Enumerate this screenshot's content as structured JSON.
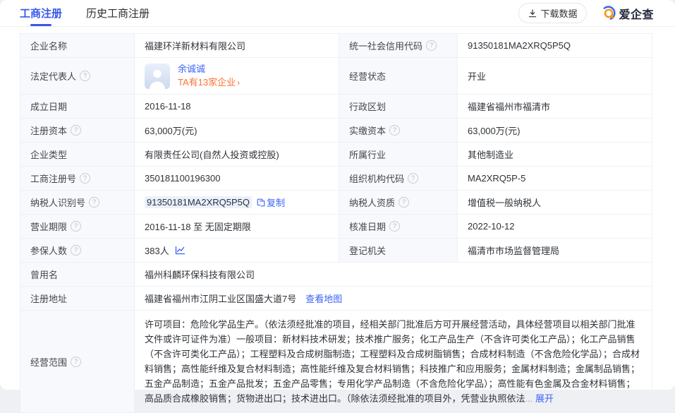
{
  "header": {
    "tabs": [
      {
        "label": "工商注册"
      },
      {
        "label": "历史工商注册"
      }
    ],
    "download_label": "下载数据",
    "brand_name": "爱企查"
  },
  "colors": {
    "accent_blue": "#3a57e8",
    "link_blue": "#3e63f6",
    "link_orange": "#ff7033",
    "brand_orange": "#ff9412",
    "brand_blue": "#2e66f6",
    "label_bg": "#f7f9fc",
    "border": "#edf0f4"
  },
  "fields": {
    "company_name": {
      "label": "企业名称",
      "value": "福建环洋新材料有限公司"
    },
    "credit_code": {
      "label": "统一社会信用代码",
      "value": "91350181MA2XRQ5P5Q"
    },
    "legal_rep": {
      "label": "法定代表人",
      "name": "余诚诚",
      "companies_link": "TA有13家企业",
      "arrow": "›"
    },
    "status": {
      "label": "经营状态",
      "value": "开业"
    },
    "established": {
      "label": "成立日期",
      "value": "2016-11-18"
    },
    "admin_division": {
      "label": "行政区划",
      "value": "福建省福州市福清市"
    },
    "reg_capital": {
      "label": "注册资本",
      "value": "63,000万(元)"
    },
    "paid_capital": {
      "label": "实缴资本",
      "value": "63,000万(元)"
    },
    "company_type": {
      "label": "企业类型",
      "value": "有限责任公司(自然人投资或控股)"
    },
    "industry": {
      "label": "所属行业",
      "value": "其他制造业"
    },
    "reg_number": {
      "label": "工商注册号",
      "value": "350181100196300"
    },
    "org_code": {
      "label": "组织机构代码",
      "value": "MA2XRQ5P-5"
    },
    "taxpayer_id": {
      "label": "纳税人识别号",
      "value": "91350181MA2XRQ5P5Q",
      "copy_label": "复制"
    },
    "taxpayer_quality": {
      "label": "纳税人资质",
      "value": "增值税一般纳税人"
    },
    "business_term": {
      "label": "营业期限",
      "value": "2016-11-18 至 无固定期限"
    },
    "approval_date": {
      "label": "核准日期",
      "value": "2022-10-12"
    },
    "insured_count": {
      "label": "参保人数",
      "value": "383人"
    },
    "registry": {
      "label": "登记机关",
      "value": "福清市市场监督管理局"
    },
    "former_name": {
      "label": "曾用名",
      "value": "福州科麟环保科技有限公司"
    },
    "address": {
      "label": "注册地址",
      "value": "福建省福州市江阴工业区国盛大道7号",
      "map_link": "查看地图"
    },
    "scope": {
      "label": "经营范围",
      "value": "许可项目：危险化学品生产。（依法须经批准的项目，经相关部门批准后方可开展经营活动，具体经营项目以相关部门批准文件或许可证件为准）一般项目：新材料技术研发；技术推广服务；化工产品生产（不含许可类化工产品）；化工产品销售（不含许可类化工产品）；工程塑料及合成树脂制造；工程塑料及合成树脂销售；合成材料制造（不含危险化学品）；合成材料销售；高性能纤维及复合材料制造；高性能纤维及复合材料销售；科技推广和应用服务；金属材料制造；金属制品销售；五金产品制造；五金产品批发；五金产品零售；专用化学产品制造（不含危险化学品）；高性能有色金属及合金材料销售；高品质合成橡胶销售；货物进出口；技术进出口。（除依法须经批准的项目外，凭营业执照依法",
      "ellipsis": "...",
      "expand_label": "展开"
    }
  },
  "help_glyph": "?"
}
